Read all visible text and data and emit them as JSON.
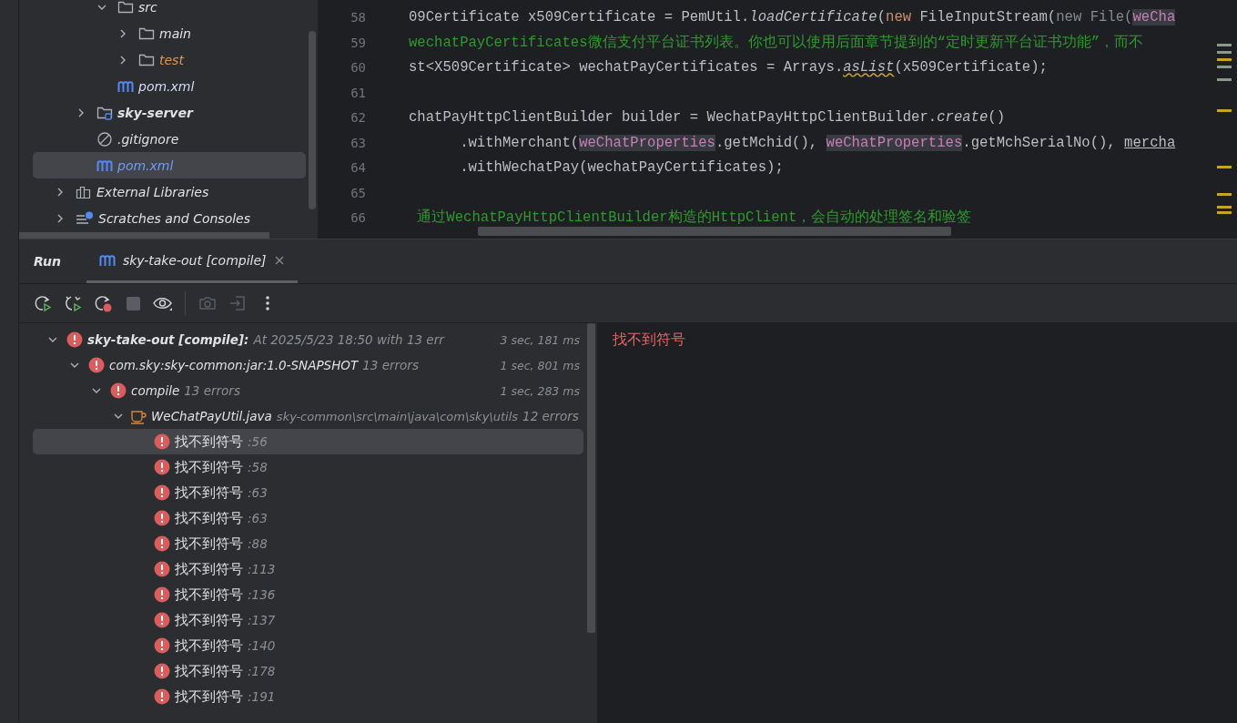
{
  "project_tree": {
    "nested_items": [
      {
        "label": "src",
        "kind": "folder",
        "expanded": true,
        "children": [
          {
            "label": "main",
            "kind": "folder",
            "expanded": false
          },
          {
            "label": "test",
            "kind": "test_folder",
            "expanded": false
          }
        ]
      },
      {
        "label": "pom.xml",
        "kind": "maven_file",
        "selected": false
      }
    ],
    "module_items": [
      {
        "label": "sky-server",
        "kind": "module",
        "expanded": false
      },
      {
        "label": ".gitignore",
        "kind": "ignore_file",
        "selected": false
      },
      {
        "label": "pom.xml",
        "kind": "maven_file",
        "selected": true
      }
    ],
    "top_items": [
      {
        "label": "External Libraries",
        "kind": "library",
        "expanded": false
      },
      {
        "label": "Scratches and Consoles",
        "kind": "scratches",
        "expanded": false
      }
    ]
  },
  "editor": {
    "lines": [
      {
        "number": "58",
        "segments": [
          {
            "kind": "plain",
            "text": "09Certificate x509Certificate = PemUtil."
          },
          {
            "kind": "italic",
            "text": "loadCertificate"
          },
          {
            "kind": "plain",
            "text": "("
          },
          {
            "kind": "keyword",
            "text": "new"
          },
          {
            "kind": "plain",
            "text": " FileInputStream("
          },
          {
            "kind": "gray",
            "text": "new File("
          },
          {
            "kind": "field_hl",
            "text": "weCha"
          }
        ]
      },
      {
        "number": "59",
        "segments": [
          {
            "kind": "comment",
            "text": "wechatPayCertificates微信支付平台证书列表。你也可以使用后面章节提到的“定时更新平台证书功能”，而不"
          }
        ]
      },
      {
        "number": "60",
        "segments": [
          {
            "kind": "plain",
            "text": "st<X509Certificate> wechatPayCertificates = Arrays."
          },
          {
            "kind": "italic_warn",
            "text": "asList"
          },
          {
            "kind": "plain",
            "text": "(x509Certificate);"
          }
        ]
      },
      {
        "number": "61"
      },
      {
        "number": "62",
        "segments": [
          {
            "kind": "plain",
            "text": "chatPayHttpClientBuilder builder = WechatPayHttpClientBuilder."
          },
          {
            "kind": "italic",
            "text": "create"
          },
          {
            "kind": "plain",
            "text": "()"
          }
        ]
      },
      {
        "number": "63",
        "segments": [
          {
            "kind": "plain",
            "text": "      .withMerchant("
          },
          {
            "kind": "field_hl",
            "text": "weChatProperties"
          },
          {
            "kind": "plain",
            "text": ".getMchid(), "
          },
          {
            "kind": "field_hl",
            "text": "weChatProperties"
          },
          {
            "kind": "plain",
            "text": ".getMchSerialNo(), "
          },
          {
            "kind": "underline",
            "text": "mercha"
          }
        ]
      },
      {
        "number": "64",
        "segments": [
          {
            "kind": "plain",
            "text": "      .withWechatPay(wechatPayCertificates);"
          }
        ]
      },
      {
        "number": "65"
      },
      {
        "number": "66",
        "segments": [
          {
            "kind": "comment",
            "text": " 通过WechatPayHttpClientBuilder构造的HttpClient，会自动的处理签名和验签"
          }
        ]
      }
    ]
  },
  "run_panel": {
    "title": "Run",
    "tab": {
      "label": "sky-take-out [compile]",
      "selected": true
    },
    "toolbar": [
      {
        "kind": "rerun",
        "disabled": false
      },
      {
        "kind": "rerun_tests",
        "disabled": false
      },
      {
        "kind": "rerun_error",
        "disabled": false
      },
      {
        "kind": "stop",
        "disabled": true
      },
      {
        "kind": "view",
        "disabled": false
      },
      {
        "kind": "camera",
        "disabled": true
      },
      {
        "kind": "export",
        "disabled": true
      },
      {
        "kind": "more",
        "disabled": false
      }
    ],
    "tree": [
      {
        "kind": "error",
        "label": "sky-take-out [compile]:",
        "detail": "At 2025/5/23 18:50 with 13 err",
        "time": "3 sec, 181 ms",
        "expanded": true,
        "children": [
          {
            "kind": "error",
            "label": "com.sky:sky-common:jar:1.0-SNAPSHOT",
            "detail": "13 errors",
            "time": "1 sec, 801 ms",
            "expanded": true,
            "children": [
              {
                "kind": "error",
                "label": "compile",
                "detail": "13 errors",
                "time": "1 sec, 283 ms",
                "expanded": true,
                "children": [
                  {
                    "kind": "java_file",
                    "label": "WeChatPayUtil.java",
                    "path": "sky-common\\src\\main\\java\\com\\sky\\utils",
                    "detail": "12 errors",
                    "expanded": true,
                    "children": [
                      {
                        "kind": "error",
                        "label": "找不到符号",
                        "detail": ":56",
                        "selected": true
                      },
                      {
                        "kind": "error",
                        "label": "找不到符号",
                        "detail": ":58",
                        "selected": false
                      },
                      {
                        "kind": "error",
                        "label": "找不到符号",
                        "detail": ":63",
                        "selected": false
                      },
                      {
                        "kind": "error",
                        "label": "找不到符号",
                        "detail": ":63",
                        "selected": false
                      },
                      {
                        "kind": "error",
                        "label": "找不到符号",
                        "detail": ":88",
                        "selected": false
                      },
                      {
                        "kind": "error",
                        "label": "找不到符号",
                        "detail": ":113",
                        "selected": false
                      },
                      {
                        "kind": "error",
                        "label": "找不到符号",
                        "detail": ":136",
                        "selected": false
                      },
                      {
                        "kind": "error",
                        "label": "找不到符号",
                        "detail": ":137",
                        "selected": false
                      },
                      {
                        "kind": "error",
                        "label": "找不到符号",
                        "detail": ":140",
                        "selected": false
                      },
                      {
                        "kind": "error",
                        "label": "找不到符号",
                        "detail": ":178",
                        "selected": false
                      },
                      {
                        "kind": "error",
                        "label": "找不到符号",
                        "detail": ":191",
                        "selected": false
                      }
                    ]
                  }
                ]
              }
            ]
          }
        ]
      }
    ],
    "output": "找不到符号"
  }
}
